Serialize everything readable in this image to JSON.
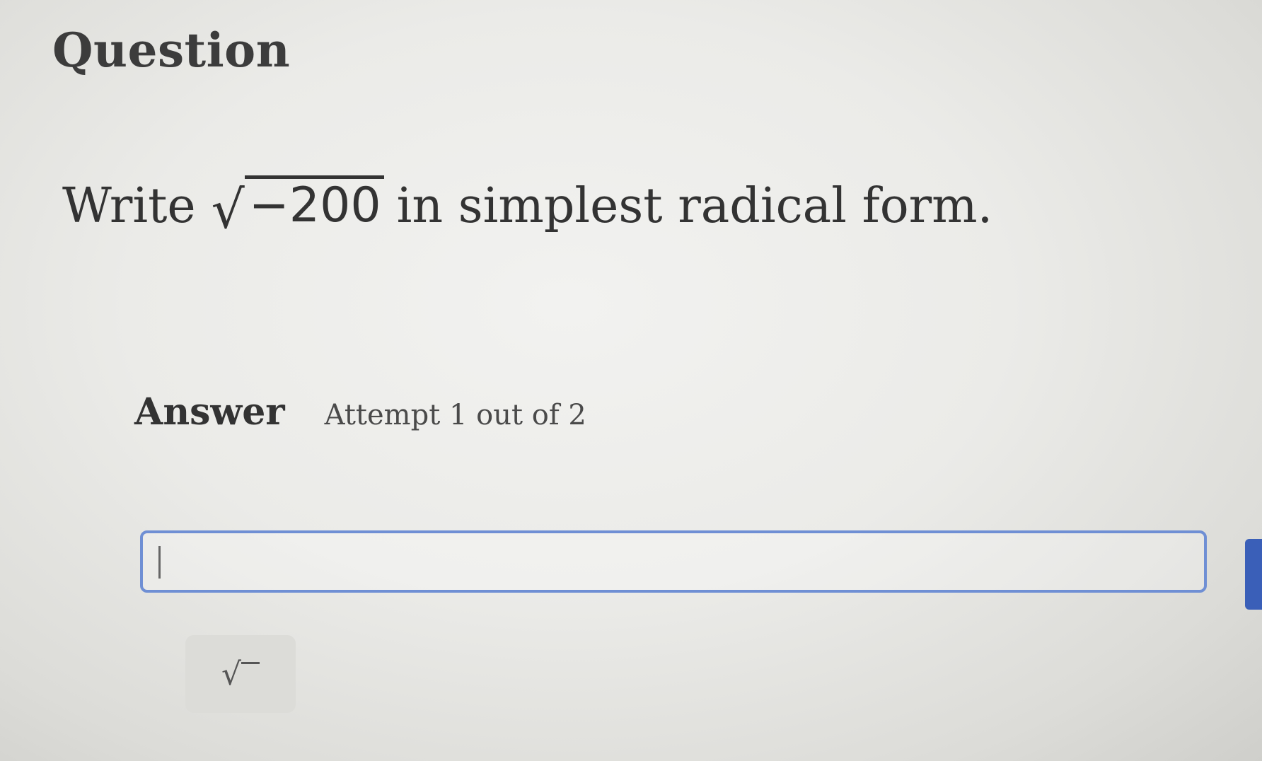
{
  "question": {
    "heading": "Question",
    "prompt_before": "Write",
    "radical_sign": "√",
    "radicand": "−200",
    "prompt_after": "in simplest radical form."
  },
  "answer": {
    "label": "Answer",
    "attempt_text": "Attempt 1 out of 2",
    "input_value": ""
  },
  "toolbar": {
    "sqrt_symbol": "√"
  },
  "colors": {
    "input_border": "#6f8fd4",
    "side_button": "#3a5fb8"
  }
}
